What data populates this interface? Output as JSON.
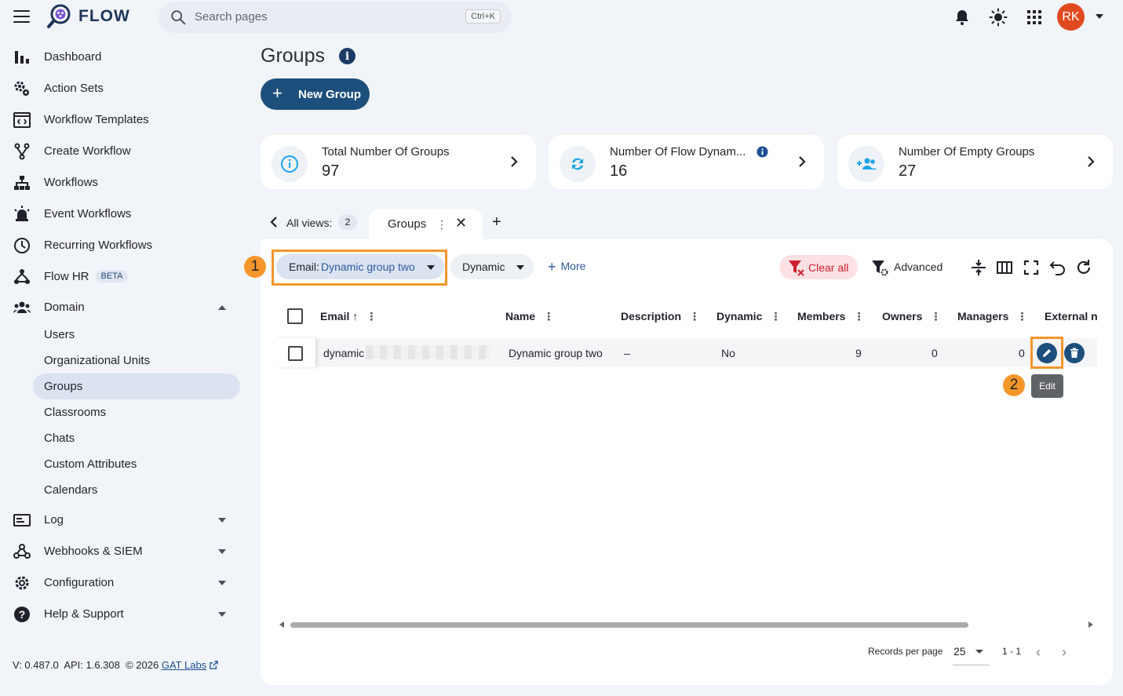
{
  "app": {
    "name": "FLOW"
  },
  "search": {
    "placeholder": "Search pages",
    "shortcut": "Ctrl+K"
  },
  "user": {
    "initials": "RK"
  },
  "colors": {
    "primary": "#1d4f7c",
    "accent_orange": "#f5962a",
    "avatar": "#e04a1f",
    "danger": "#d0202e"
  },
  "sidebar": {
    "items": [
      {
        "label": "Dashboard",
        "icon": "bar-chart-icon"
      },
      {
        "label": "Action Sets",
        "icon": "gears-icon"
      },
      {
        "label": "Workflow Templates",
        "icon": "template-icon"
      },
      {
        "label": "Create Workflow",
        "icon": "fork-icon"
      },
      {
        "label": "Workflows",
        "icon": "hierarchy-icon"
      },
      {
        "label": "Event Workflows",
        "icon": "siren-icon"
      },
      {
        "label": "Recurring Workflows",
        "icon": "clock-icon"
      },
      {
        "label": "Flow HR",
        "badge": "BETA",
        "icon": "people-tree-icon"
      },
      {
        "label": "Domain",
        "icon": "users-icon"
      }
    ],
    "domain_sub": [
      "Users",
      "Organizational Units",
      "Groups",
      "Classrooms",
      "Chats",
      "Custom Attributes",
      "Calendars"
    ],
    "bottom_items": [
      {
        "label": "Log",
        "icon": "log-icon"
      },
      {
        "label": "Webhooks & SIEM",
        "icon": "webhook-icon"
      },
      {
        "label": "Configuration",
        "icon": "gear-icon"
      },
      {
        "label": "Help & Support",
        "icon": "help-icon"
      }
    ],
    "version": "V: 0.487.0",
    "api": "API: 1.6.308",
    "copyright": "© 2026",
    "company": "GAT Labs"
  },
  "page": {
    "title": "Groups",
    "new_button": "New Group"
  },
  "cards": [
    {
      "title": "Total Number Of Groups",
      "value": "97",
      "icon": "info-circle-icon"
    },
    {
      "title": "Number Of Flow Dynam...",
      "value": "16",
      "icon": "sync-icon"
    },
    {
      "title": "Number Of Empty Groups",
      "value": "27",
      "icon": "group-add-icon"
    }
  ],
  "views": {
    "label": "All views:",
    "count": "2",
    "active_tab": "Groups"
  },
  "filters": {
    "email_key": "Email:",
    "email_value": "Dynamic group two",
    "dynamic_label": "Dynamic",
    "more_label": "More",
    "clear_all": "Clear all",
    "advanced": "Advanced"
  },
  "annotations": {
    "step1": "1",
    "step2": "2"
  },
  "table": {
    "columns": [
      "Email",
      "Name",
      "Description",
      "Dynamic",
      "Members",
      "Owners",
      "Managers",
      "External n"
    ],
    "rows": [
      {
        "email": "dynamic",
        "name": "Dynamic group two",
        "description": "–",
        "dynamic": "No",
        "members": "9",
        "owners": "0",
        "managers": "0"
      }
    ],
    "edit_tooltip": "Edit"
  },
  "pager": {
    "label": "Records per page",
    "per_page": "25",
    "range": "1 - 1"
  }
}
